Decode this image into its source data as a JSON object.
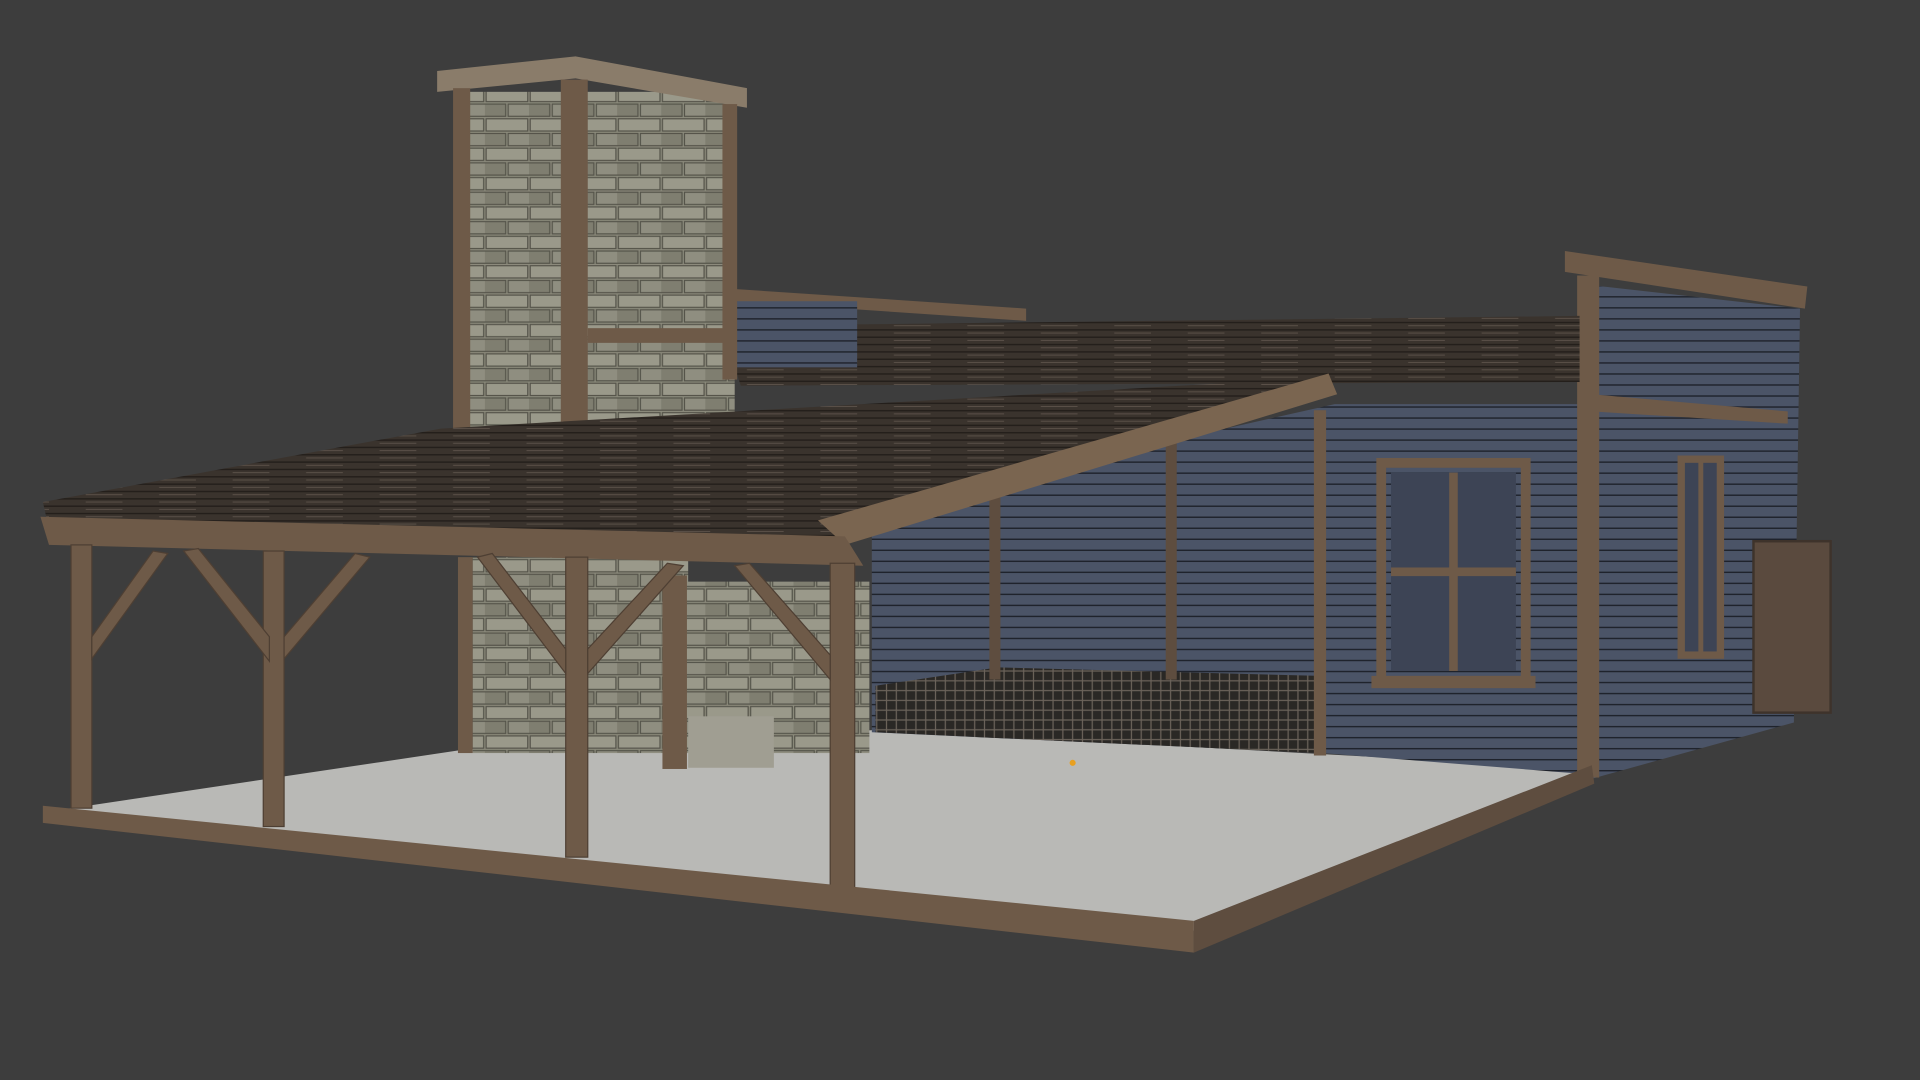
{
  "scene": {
    "subject": "wooden-workshop-with-stone-chimney",
    "colors": {
      "background": "#3d3d3d",
      "wood": "#6e5a48",
      "wood_dark": "#4e3f33",
      "roof": "#3a332d",
      "stone": "#8c8b7c",
      "wall_blue": "#4b5467",
      "floor": "#b9b9b6",
      "origin_marker": "#e8a020"
    }
  }
}
